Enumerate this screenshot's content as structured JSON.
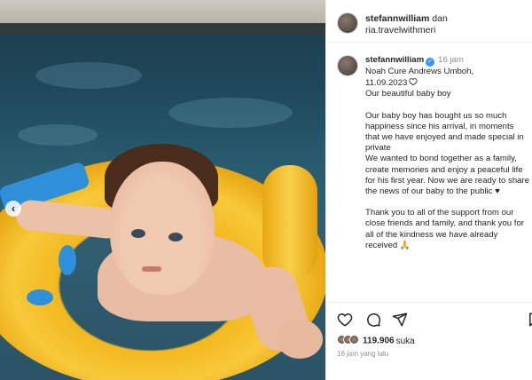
{
  "post": {
    "header": {
      "user1": "stefannwilliam",
      "connector": "dan",
      "user2": "ria.travelwithmeri"
    },
    "caption": {
      "username": "stefannwilliam",
      "time": "16 jam",
      "title_line1": "Noah Cure Andrews Umboh,",
      "title_line2": "11.09.2023",
      "line_beautiful": "Our beautiful baby boy",
      "para1": "Our baby boy has bought us so much happiness since his arrival, in moments that we have enjoyed and made special in private",
      "para2": "We wanted to bond together as a family, create memories and enjoy a peaceful life for his first year. Now we are ready to share the news of our baby to the public ♥",
      "para3": "Thank you to all of the support from our close friends and family, and thank you for all of the kindness we have already received 🙏"
    },
    "likes_count": "119.906",
    "likes_label": "suka",
    "posted_ago": "16 jam yang lalu",
    "carousel_prev": "‹"
  },
  "icons": {
    "like": "heart-icon",
    "comment": "comment-icon",
    "share": "share-icon",
    "save": "bookmark-icon"
  },
  "colors": {
    "verified": "#3897f0",
    "text": "#262626",
    "muted": "#8e8e8e"
  }
}
